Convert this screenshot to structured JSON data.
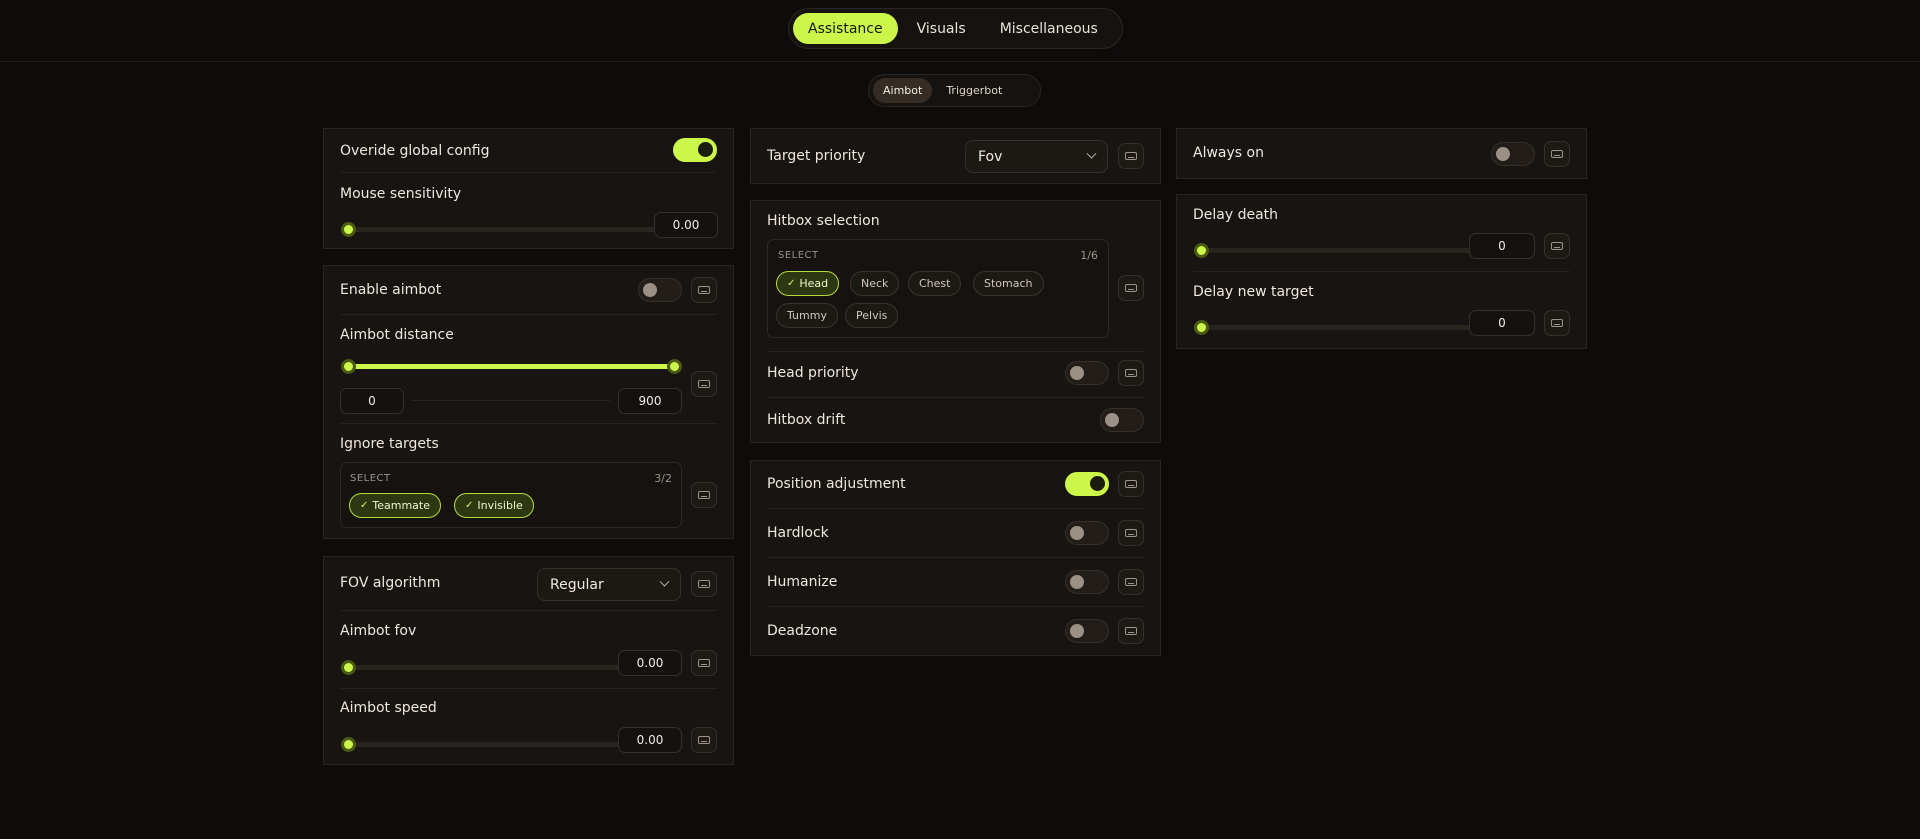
{
  "nav": {
    "tabs": [
      {
        "label": "Assistance",
        "active": true
      },
      {
        "label": "Visuals",
        "active": false
      },
      {
        "label": "Miscellaneous",
        "active": false
      }
    ]
  },
  "subnav": {
    "tabs": [
      {
        "label": "Aimbot",
        "active": true
      },
      {
        "label": "Triggerbot",
        "active": false
      }
    ]
  },
  "colors": {
    "accent": "#cdf64a",
    "background": "#0e0c0a",
    "panel": "#171411"
  },
  "icons": {
    "key_bind": "keyboard-icon",
    "dropdown": "chevron-down-icon",
    "chip_check": "check-icon"
  },
  "col1": {
    "override": {
      "label": "Overide global config",
      "on": true
    },
    "mouse_sensitivity": {
      "label": "Mouse sensitivity",
      "value": "0.00",
      "level": 0
    },
    "enable_aimbot": {
      "label": "Enable aimbot",
      "on": false
    },
    "aimbot_distance": {
      "label": "Aimbot distance",
      "min": "0",
      "max": "900",
      "range": [
        0,
        1
      ]
    },
    "ignore_targets": {
      "label": "Ignore targets",
      "select_label": "SELECT",
      "count": "3/2",
      "chips": [
        {
          "label": "Teammate",
          "selected": true,
          "check": "✓"
        },
        {
          "label": "Invisible",
          "selected": true,
          "check": "✓"
        }
      ]
    },
    "fov_algorithm": {
      "label": "FOV algorithm",
      "value": "Regular"
    },
    "aimbot_fov": {
      "label": "Aimbot fov",
      "value": "0.00",
      "level": 0
    },
    "aimbot_speed": {
      "label": "Aimbot speed",
      "value": "0.00",
      "level": 0
    }
  },
  "col2": {
    "target_priority": {
      "label": "Target priority",
      "value": "Fov"
    },
    "hitbox_selection": {
      "label": "Hitbox selection",
      "select_label": "SELECT",
      "count": "1/6",
      "chips": [
        {
          "label": "Head",
          "selected": true,
          "check": "✓"
        },
        {
          "label": "Neck",
          "selected": false
        },
        {
          "label": "Chest",
          "selected": false
        },
        {
          "label": "Stomach",
          "selected": false
        },
        {
          "label": "Tummy",
          "selected": false
        },
        {
          "label": "Pelvis",
          "selected": false
        }
      ]
    },
    "head_priority": {
      "label": "Head priority",
      "on": false
    },
    "hitbox_drift": {
      "label": "Hitbox drift",
      "on": false
    },
    "position_adjustment": {
      "label": "Position adjustment",
      "on": true
    },
    "hardlock": {
      "label": "Hardlock",
      "on": false
    },
    "humanize": {
      "label": "Humanize",
      "on": false
    },
    "deadzone": {
      "label": "Deadzone",
      "on": false
    }
  },
  "col3": {
    "always_on": {
      "label": "Always on",
      "on": false
    },
    "delay_death": {
      "label": "Delay death",
      "value": "0",
      "level": 0
    },
    "delay_new_target": {
      "label": "Delay new target",
      "value": "0",
      "level": 0
    }
  }
}
